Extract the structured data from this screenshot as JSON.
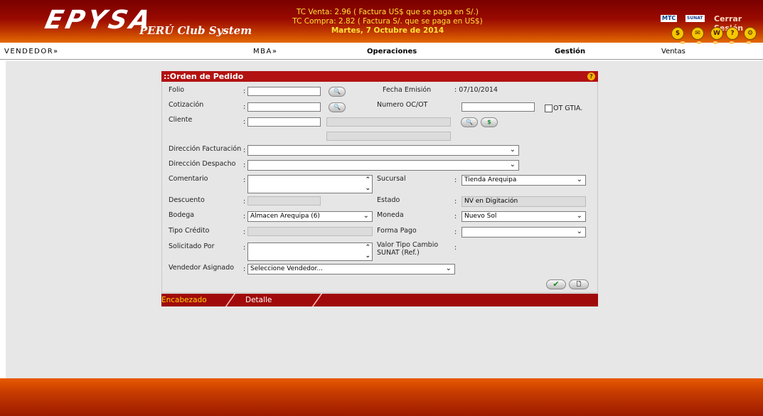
{
  "header": {
    "logo_main": "EPYSA",
    "logo_sub": "PERÚ Club System",
    "tc_venta": "TC Venta: 2.96 ( Factura US$ que se paga en S/.)",
    "tc_compra": "TC Compra: 2.82 ( Factura S/. que se paga en US$)",
    "date": "Martes, 7 Octubre de 2014",
    "mini_logo_1": "MTC",
    "mini_logo_2": "SUNAT",
    "logout": "Cerrar Sesión",
    "icons": [
      "coins-icon",
      "mail-icon",
      "money-icon",
      "help-icon",
      "settings-icon"
    ]
  },
  "nav": {
    "vendedor": "VENDEDOR»",
    "mba": "MBA»",
    "operaciones": "Operaciones",
    "gestion": "Gestión",
    "ventas": "Ventas"
  },
  "form": {
    "title": "::Orden de Pedido",
    "folio_label": "Folio",
    "fecha_label": "Fecha Emisión",
    "fecha_value": ": 07/10/2014",
    "cotizacion_label": "Cotización",
    "numero_label": "Numero OC/OT",
    "ot_label": "OT GTIA.",
    "cliente_label": "Cliente",
    "direccion_fact_label": "Dirección Facturación",
    "direccion_desp_label": "Dirección Despacho",
    "comentario_label": "Comentario",
    "sucursal_label": "Sucursal",
    "sucursal_value": "Tienda Arequipa",
    "descuento_label": "Descuento",
    "estado_label": "Estado",
    "estado_value": "NV en Digitación",
    "bodega_label": "Bodega",
    "bodega_value": "Almacen Arequipa (6)",
    "moneda_label": "Moneda",
    "moneda_value": "Nuevo Sol",
    "tipo_credito_label": "Tipo Crédito",
    "forma_pago_label": "Forma Pago",
    "solicitado_label": "Solicitado Por",
    "valor_tc_label_1": "Valor Tipo Cambio",
    "valor_tc_label_2": "SUNAT (Ref.)",
    "vendedor_label": "Vendedor Asignado",
    "vendedor_value": "Seleccione Vendedor...",
    "colon": ":"
  },
  "tabs": {
    "encabezado": "Encabezado",
    "detalle": "Detalle"
  }
}
